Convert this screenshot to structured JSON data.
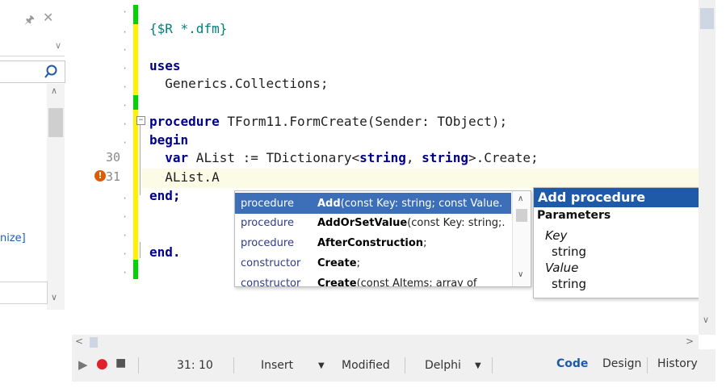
{
  "left_panel": {
    "pin_icon": "pin-icon",
    "close_icon": "close-icon",
    "partial_text": "nize]"
  },
  "editor": {
    "comment_line": "{$R *.dfm}",
    "uses_kw": "uses",
    "uses_unit": "  Generics.Collections;",
    "proc_kw": "procedure",
    "proc_sig": " TForm11.FormCreate(Sender: TObject);",
    "begin_kw": "begin",
    "var_kw": "  var",
    "var_a": " AList := TDictionary<",
    "string_kw": "string",
    "var_b": ", ",
    "var_c": ">.Create;",
    "current_line": "  AList.A",
    "end_kw": "end;",
    "end_dot_kw": "end.",
    "line_numbers": [
      "30",
      "31"
    ]
  },
  "completion": {
    "items": [
      {
        "kind": "procedure",
        "name": "Add",
        "params": "(const Key: string; const Value."
      },
      {
        "kind": "procedure",
        "name": "AddOrSetValue",
        "params": "(const Key: string;."
      },
      {
        "kind": "procedure",
        "name": "AfterConstruction",
        "params": ";"
      },
      {
        "kind": "constructor",
        "name": "Create",
        "params": ";"
      },
      {
        "kind": "constructor",
        "name": "Create",
        "params": "(const AItems: array of"
      }
    ]
  },
  "help": {
    "title": "Add procedure",
    "section": "Parameters",
    "params": [
      {
        "name": "Key",
        "type": "string"
      },
      {
        "name": "Value",
        "type": "string"
      }
    ]
  },
  "status": {
    "position": "31: 10",
    "mode": "Insert",
    "modified": "Modified",
    "language": "Delphi",
    "tabs": {
      "code": "Code",
      "design": "Design",
      "history": "History"
    }
  }
}
